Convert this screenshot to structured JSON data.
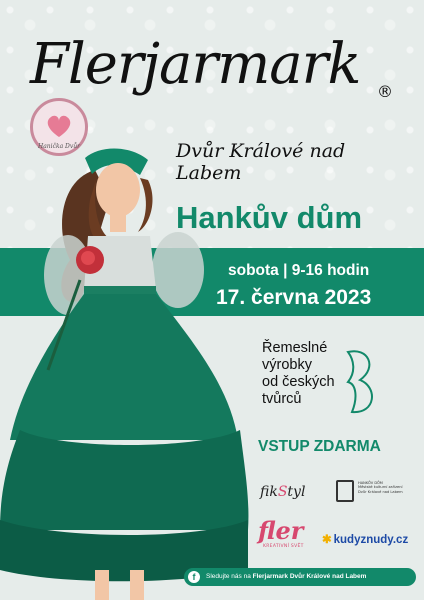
{
  "title": "Flerjarmark",
  "registered_mark": "®",
  "subtitle": "Dvůr Králové nad Labem",
  "badge_text": "Hanička Dvůr",
  "venue": "Hankův dům",
  "date_line1": "sobota | 9-16 hodin",
  "date_line2": "17. června 2023",
  "crafts": [
    "Řemeslné",
    "výrobky",
    "od českých",
    "tvůrců"
  ],
  "entry": "VSTUP ZDARMA",
  "sponsors": {
    "fikstyl_a": "fik",
    "fikstyl_s": "S",
    "fikstyl_b": "tyl",
    "dum_lines": [
      "HANKŮV DŮM",
      "Městské kulturní zařízení",
      "Dvůr Králové nad Labem"
    ],
    "fler": "fler",
    "fler_sub": "KREATIVNÍ SVĚT",
    "kudyznudy": "kudyznudy.cz"
  },
  "footer": {
    "prefix": "Sledujte nás na",
    "name": "Flerjarmark Dvůr Králové nad Labem"
  },
  "colors": {
    "accent": "#12896a",
    "pink": "#d7486f",
    "background": "#e6ecea"
  },
  "icons": [
    "facebook-icon",
    "butterfly-icon",
    "rose-icon"
  ]
}
